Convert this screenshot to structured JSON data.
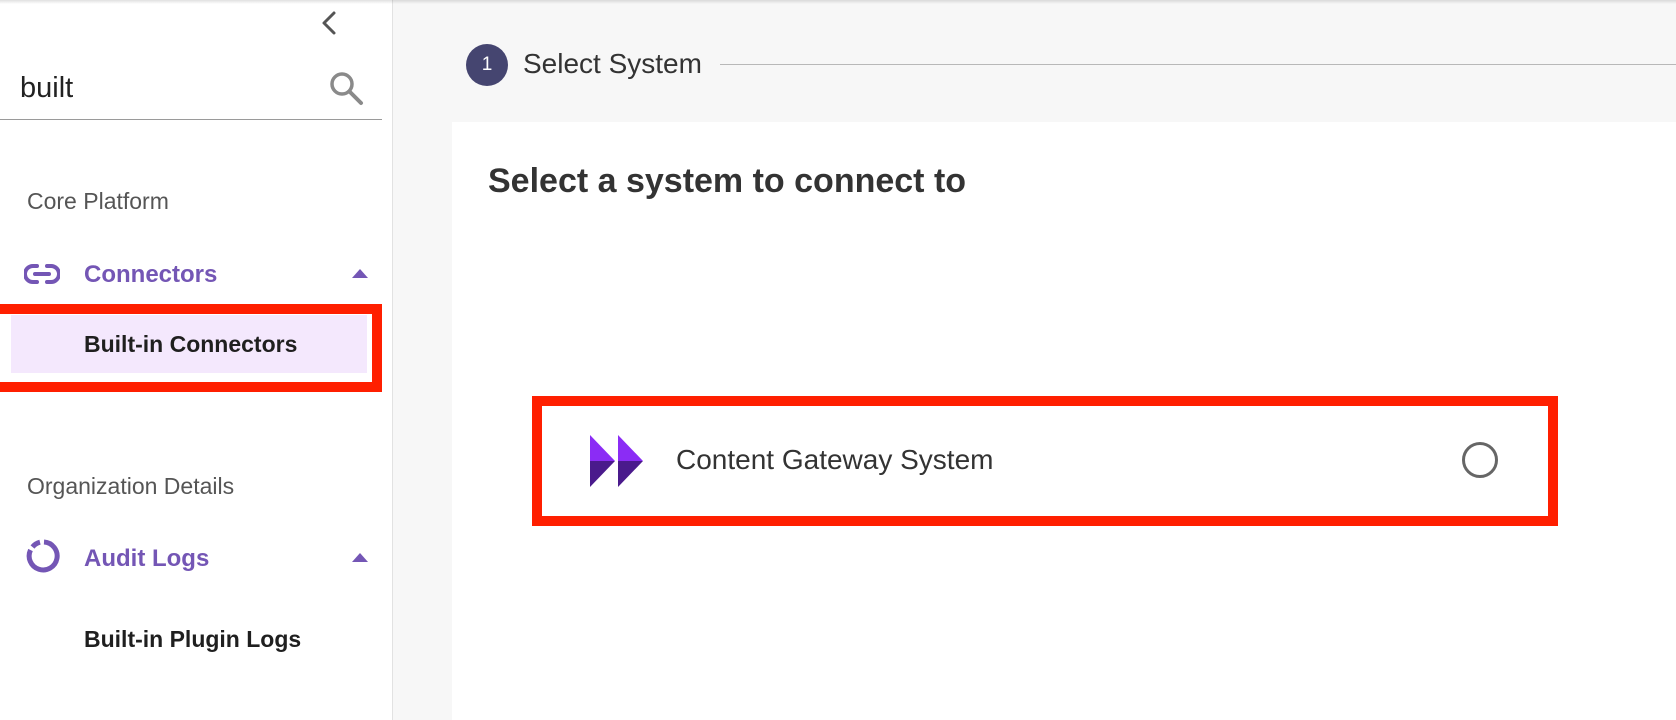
{
  "sidebar": {
    "search": {
      "value": "built",
      "placeholder": ""
    },
    "sections": [
      {
        "title": "Core Platform",
        "group": {
          "label": "Connectors",
          "icon": "link-icon",
          "expanded": true,
          "items": [
            {
              "label": "Built-in Connectors",
              "active": true
            }
          ]
        }
      },
      {
        "title": "Organization Details",
        "group": {
          "label": "Audit Logs",
          "icon": "circle-progress-icon",
          "expanded": true,
          "items": [
            {
              "label": "Built-in Plugin Logs",
              "active": false
            }
          ]
        }
      }
    ]
  },
  "stepper": {
    "steps": [
      {
        "number": "1",
        "label": "Select System"
      }
    ]
  },
  "main": {
    "title": "Select a system to connect to",
    "systems": [
      {
        "name": "Content Gateway System",
        "logo": "content-gateway-logo",
        "selected": false
      }
    ]
  },
  "colors": {
    "accent": "#7456b5",
    "active_bg": "#f4e8fd",
    "step_circle": "#454570",
    "highlight": "#ff1f00",
    "logo_light": "#8b2cf5",
    "logo_dark": "#4a1a8c"
  }
}
